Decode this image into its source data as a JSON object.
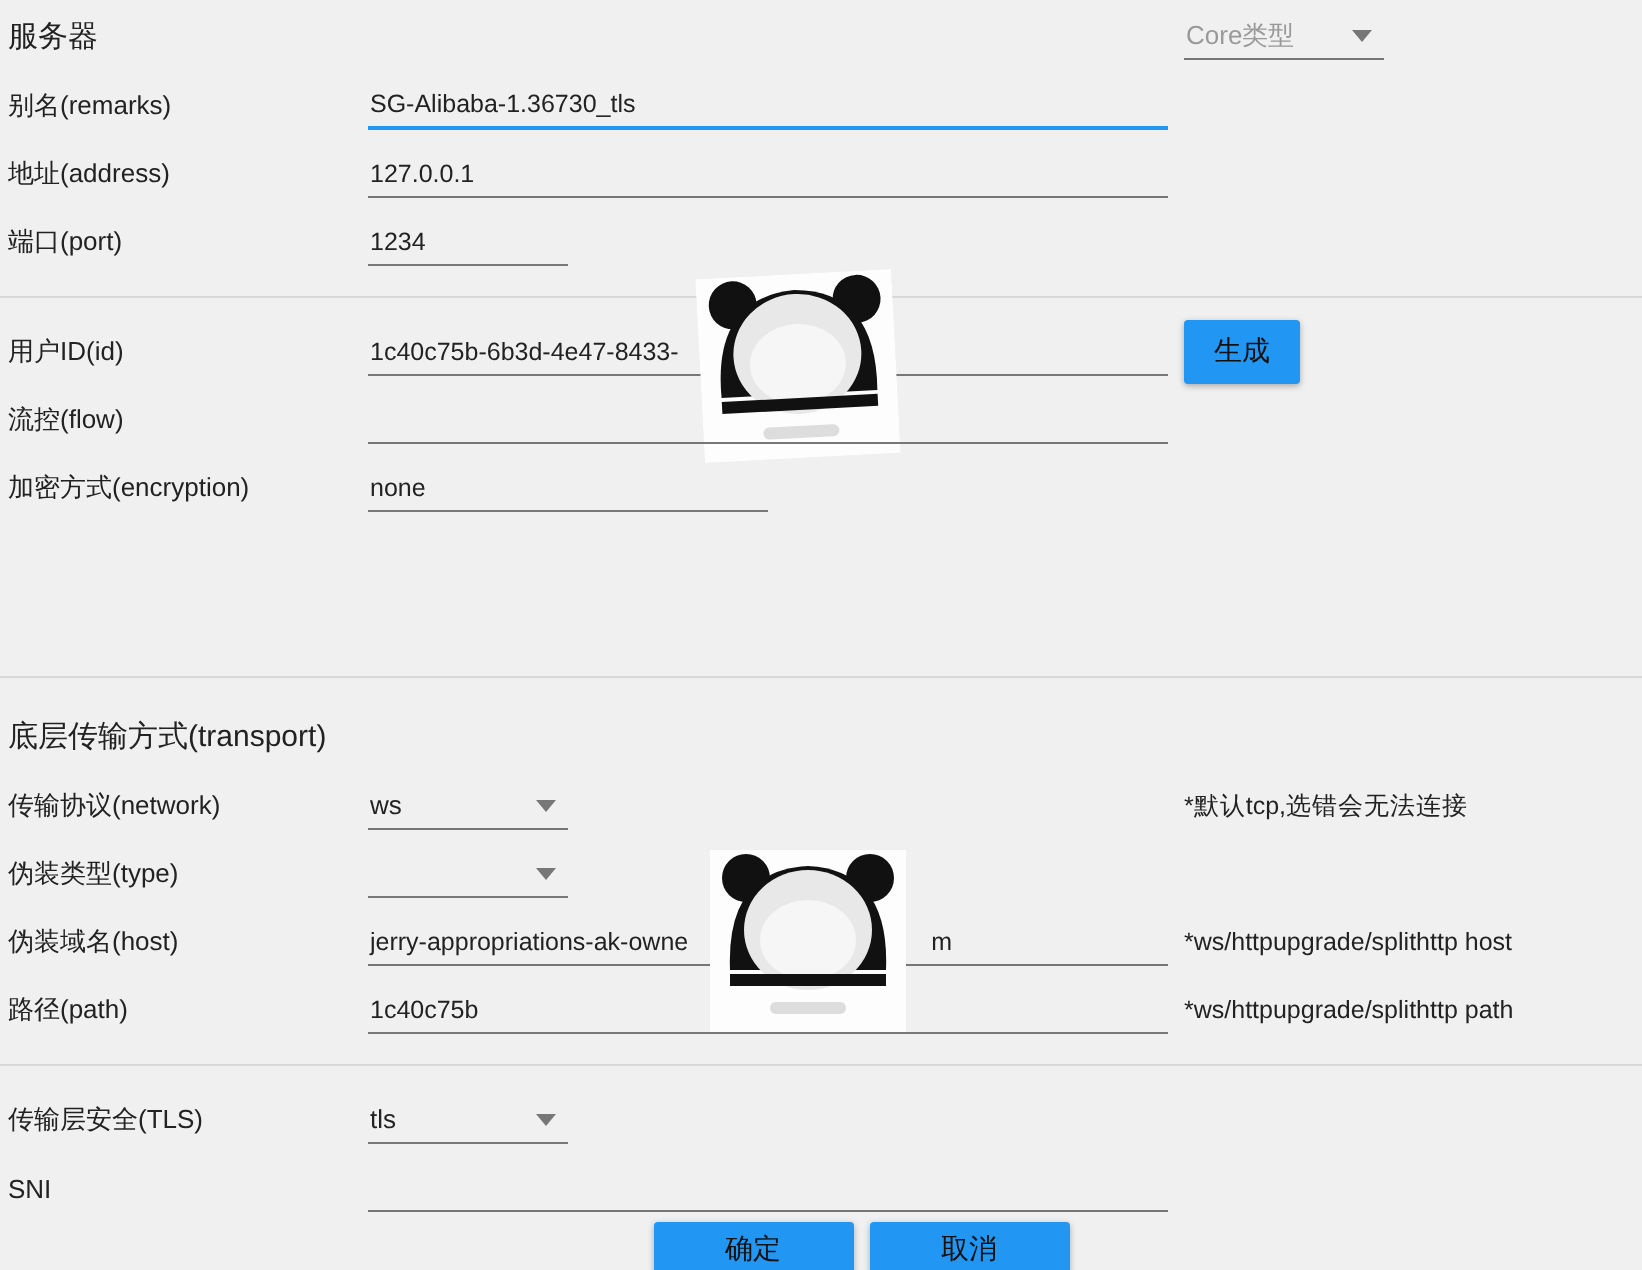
{
  "sections": [
    {
      "title": "服务器",
      "header_select": {
        "placeholder": "Core类型"
      },
      "rows": [
        {
          "kind": "text",
          "label": "别名(remarks)",
          "value": "SG-Alibaba-1.36730_tls",
          "focused": true
        },
        {
          "kind": "text",
          "label": "地址(address)",
          "value": "127.0.0.1",
          "focused": false
        },
        {
          "kind": "text",
          "label": "端口(port)",
          "value": "1234",
          "focused": false
        }
      ]
    },
    {
      "rows": [
        {
          "kind": "text",
          "label": "用户ID(id)",
          "value": "1c40c75b-6b3d-4e47-8433-",
          "focused": false,
          "action": {
            "label": "生成"
          }
        },
        {
          "kind": "text",
          "label": "流控(flow)",
          "focused": false
        },
        {
          "kind": "text",
          "label": "加密方式(encryption)",
          "value": "none",
          "focused": false
        }
      ]
    },
    {
      "title": "底层传输方式(transport)",
      "rows": [
        {
          "kind": "select",
          "label": "传输协议(network)",
          "value": "ws",
          "hint": "*默认tcp,选错会无法连接"
        },
        {
          "kind": "select",
          "label": "伪装类型(type)"
        },
        {
          "kind": "text",
          "label": "伪装域名(host)",
          "value": "jerry-appropriations-ak-owne",
          "value_tail": "m",
          "focused": false,
          "hint": "*ws/httpupgrade/splithttp host"
        },
        {
          "kind": "text",
          "label": "路径(path)",
          "value": "1c40c75b",
          "focused": false,
          "hint": "*ws/httpupgrade/splithttp path"
        }
      ]
    },
    {
      "rows": [
        {
          "kind": "select",
          "label": "传输层安全(TLS)",
          "value": "tls"
        },
        {
          "kind": "text",
          "label": "SNI",
          "focused": false
        }
      ]
    }
  ],
  "buttons": [
    "确定",
    "取消"
  ]
}
